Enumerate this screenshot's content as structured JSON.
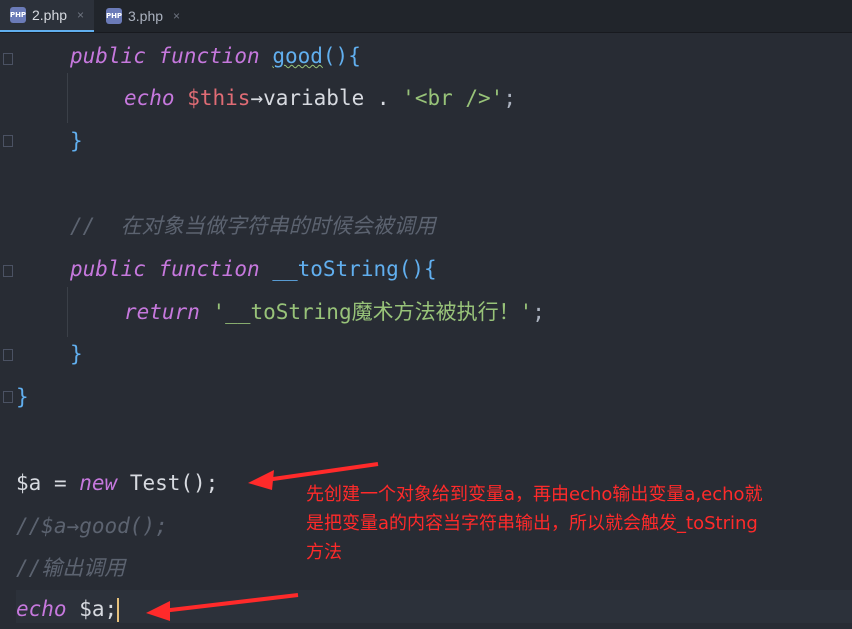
{
  "tabs": [
    {
      "label": "2.php",
      "icon": "PHP",
      "close": "×"
    },
    {
      "label": "3.php",
      "icon": "PHP",
      "close": "×"
    }
  ],
  "code": {
    "l1": {
      "kw1": "public",
      "kw2": "function",
      "name": "good",
      "rest": "(){"
    },
    "l2": {
      "kw": "echo",
      "var": "$this",
      "arrow": "→variable . ",
      "str": "'<br />'",
      "end": ";"
    },
    "l3": {
      "brace": "}"
    },
    "l5": {
      "comment": "//  在对象当做字符串的时候会被调用"
    },
    "l6": {
      "kw1": "public",
      "kw2": "function",
      "name": "__toString",
      "rest": "(){"
    },
    "l7": {
      "kw": "return",
      "str": "'__toString魔术方法被执行！'",
      "end": ";"
    },
    "l8": {
      "brace": "}"
    },
    "l9": {
      "brace": "}"
    },
    "l11": {
      "var": "$a",
      "eq": " = ",
      "kw": "new",
      "cls": " Test",
      "end": "();"
    },
    "l12": {
      "comment": "//$a→good();"
    },
    "l13": {
      "comment": "//输出调用"
    },
    "l14": {
      "kw": "echo",
      "var": " $a",
      "end": ";"
    }
  },
  "annotation": {
    "text1": "先创建一个对象给到变量a，再由echo输出变量a,echo就",
    "text2": "是把变量a的内容当字符串输出，所以就会触发_toString",
    "text3": "方法"
  },
  "colors": {
    "annotation": "#ff2a2a",
    "background": "#282c34"
  }
}
